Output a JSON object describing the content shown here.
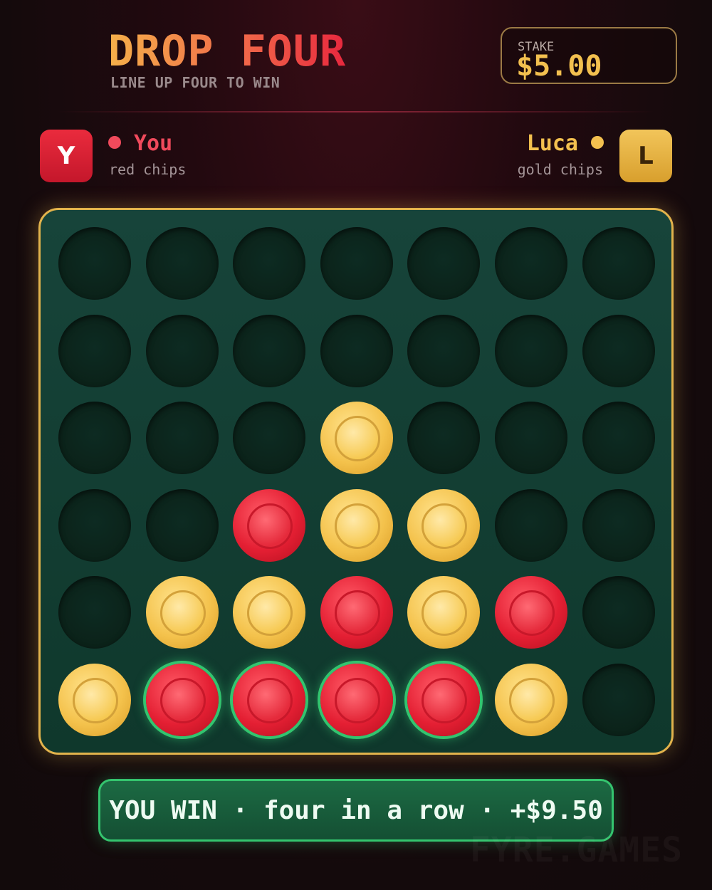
{
  "header": {
    "title": "DROP FOUR",
    "subtitle": "LINE UP FOUR TO WIN",
    "stake_label": "STAKE",
    "stake_amount": "$5.00"
  },
  "players": {
    "you": {
      "avatar_letter": "Y",
      "name": "You",
      "chips": "red chips",
      "color": "#e8283e"
    },
    "opponent": {
      "avatar_letter": "L",
      "name": "Luca",
      "chips": "gold chips",
      "color": "#f3c04f"
    }
  },
  "board": {
    "columns": 7,
    "rows": 6,
    "grid": [
      [
        "empty",
        "empty",
        "empty",
        "empty",
        "empty",
        "empty",
        "empty"
      ],
      [
        "empty",
        "empty",
        "empty",
        "empty",
        "empty",
        "empty",
        "empty"
      ],
      [
        "empty",
        "empty",
        "empty",
        "gold",
        "empty",
        "empty",
        "empty"
      ],
      [
        "empty",
        "empty",
        "red",
        "gold",
        "gold",
        "empty",
        "empty"
      ],
      [
        "empty",
        "gold",
        "gold",
        "red",
        "gold",
        "red",
        "empty"
      ],
      [
        "gold",
        "red",
        "red",
        "red",
        "red",
        "gold",
        "empty"
      ]
    ],
    "winning_cells": [
      [
        5,
        1
      ],
      [
        5,
        2
      ],
      [
        5,
        3
      ],
      [
        5,
        4
      ]
    ],
    "frame_color": "#e2b34c",
    "win_highlight_color": "#33c46f"
  },
  "result": {
    "text": "YOU WIN · four in a row · +$9.50"
  },
  "watermark": "FYRE.GAMES"
}
